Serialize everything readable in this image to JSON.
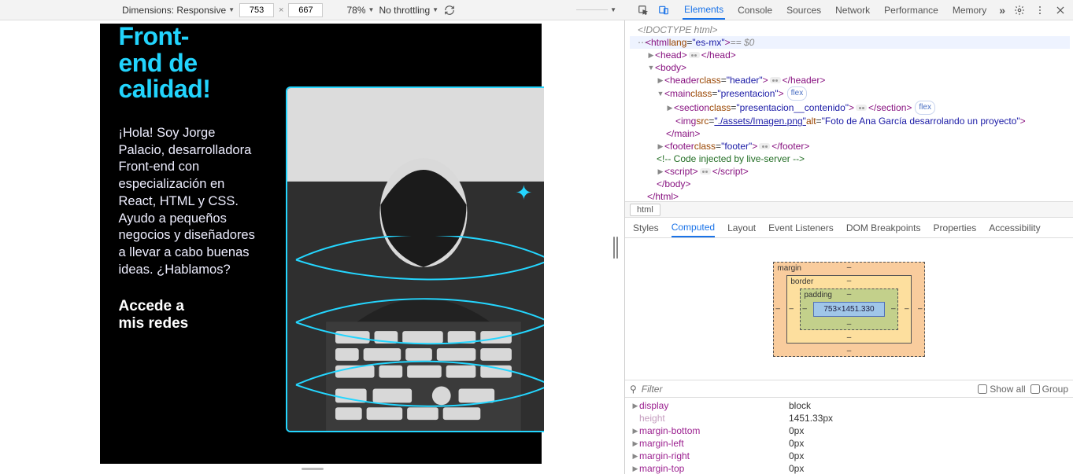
{
  "toolbar": {
    "dimensions_label": "Dimensions: Responsive",
    "width": "753",
    "height": "667",
    "zoom": "78%",
    "throttling": "No throttling"
  },
  "devtools_tabs": [
    "Elements",
    "Console",
    "Sources",
    "Network",
    "Performance",
    "Memory"
  ],
  "devtools_active": "Elements",
  "dom": {
    "doctype": "<!DOCTYPE html>",
    "html_open": "<html lang=\"es-mx\">",
    "html_suffix": " == $0",
    "head": {
      "open": "<head>",
      "close": "</head>"
    },
    "body_open": "<body>",
    "header": {
      "open": "<header class=\"header\">",
      "close": "</header>"
    },
    "main": {
      "open": "<main class=\"presentacion\">",
      "pill": "flex"
    },
    "section": {
      "open": "<section class=\"presentacion__contenido\">",
      "close": "</section>",
      "pill": "flex"
    },
    "img": {
      "open": "<img src=",
      "src": "\"./assets/Imagen.png\"",
      "rest": " alt=\"Foto de Ana García desarrolando un proyecto\">"
    },
    "main_close": "</main>",
    "footer": {
      "open": "<footer class=\"footer\">",
      "close": "</footer>"
    },
    "comment": "<!-- Code injected by live-server -->",
    "script": {
      "open": "<script>",
      "close": "</script>"
    },
    "body_close": "</body>",
    "html_close": "</html>"
  },
  "crumb": "html",
  "subtabs": [
    "Styles",
    "Computed",
    "Layout",
    "Event Listeners",
    "DOM Breakpoints",
    "Properties",
    "Accessibility"
  ],
  "subtabs_active": "Computed",
  "boxmodel": {
    "margin": "margin",
    "border": "border",
    "padding": "padding",
    "content": "753×1451.330",
    "dash": "–"
  },
  "filter": {
    "placeholder": "Filter",
    "showall": "Show all",
    "group": "Group"
  },
  "computed": [
    {
      "k": "display",
      "v": "block",
      "emph": true
    },
    {
      "k": "height",
      "v": "1451.33px",
      "emph": false
    },
    {
      "k": "margin-bottom",
      "v": "0px",
      "emph": true
    },
    {
      "k": "margin-left",
      "v": "0px",
      "emph": true
    },
    {
      "k": "margin-right",
      "v": "0px",
      "emph": true
    },
    {
      "k": "margin-top",
      "v": "0px",
      "emph": true
    }
  ],
  "page": {
    "title_line1": "Front-",
    "title_line2": "end de",
    "title_line3": "calidad!",
    "paragraph": "¡Hola! Soy Jorge Palacio, desarrolladora Front-end con especialización en React, HTML y CSS. Ayudo a pequeños negocios y diseñadores a llevar a cabo buenas ideas. ¿Hablamos?",
    "redes_l1": "Accede a",
    "redes_l2": "mis redes"
  }
}
